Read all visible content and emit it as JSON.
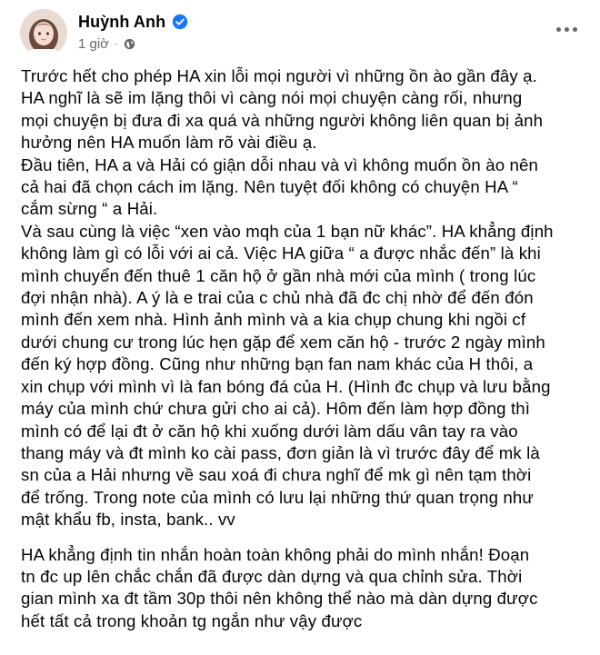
{
  "post": {
    "author": "Huỳnh Anh",
    "time": "1 giờ",
    "privacy_icon": "globe-icon",
    "verified_icon": "verified-badge-icon",
    "more_icon": "more-options-icon",
    "accent_color": "#1877f2",
    "paragraph1_lines": [
      "Trước hết cho phép HA xin lỗi mọi người vì những ồn ào gần đây ạ.",
      "HA nghĩ là sẽ im lặng thôi vì càng nói mọi chuyện càng rối, nhưng",
      "mọi chuyện bị đưa đi xa quá và những người không liên quan bị ảnh",
      "hưởng nên HA muốn làm rõ vài điều ạ.",
      "Đầu tiên, HA a và Hải có giận dỗi nhau và vì không muốn ồn ào nên",
      "cả hai đã chọn cách im lặng. Nên tuyệt đối không có chuyện HA “",
      "cắm sừng “ a Hải.",
      "Và sau cùng là việc “xen vào mqh của 1 bạn nữ khác”. HA khẳng định",
      "không làm gì có lỗi với ai cả. Việc HA giữa “ a được nhắc đến”  là khi",
      "mình chuyển đến thuê 1 căn hộ ở gần nhà mới của mình ( trong lúc",
      "đợi nhận nhà). A ý là e trai của c chủ nhà đã đc chị nhờ để đến đón",
      "mình đến xem nhà. Hình ảnh mình và a kia chụp chung khi ngồi cf",
      "dưới chung cư trong lúc hẹn gặp để xem căn hộ - trước 2 ngày mình",
      "đến ký hợp đồng. Cũng như những bạn fan nam khác của H thôi, a",
      "xin chụp với mình vì là fan bóng đá của H. (Hình đc chụp và lưu bằng",
      "máy của mình chứ chưa gửi cho ai cả). Hôm đến làm hợp đồng thì",
      "mình có để lại đt ở căn hộ khi xuống dưới làm dấu vân tay ra vào",
      "thang máy và đt mình ko cài pass, đơn giản là vì trước đây để mk là",
      "sn của a Hải nhưng về sau xoá đi chưa nghĩ để mk gì nên tạm thời",
      "để trống. Trong note của mình có lưu lại những thứ quan trọng như",
      "mật khẩu fb, insta, bank.. vv"
    ],
    "paragraph2_lines": [
      "HA khẳng định tin nhắn hoàn toàn không phải do mình nhắn! Đoạn",
      "tn đc up lên chắc chắn đã được dàn dựng và qua chỉnh sửa. Thời",
      "gian mình xa đt tầm 30p thôi nên không thể nào mà dàn dựng được",
      "hết tất cả trong khoản tg ngắn như vậy được"
    ]
  }
}
